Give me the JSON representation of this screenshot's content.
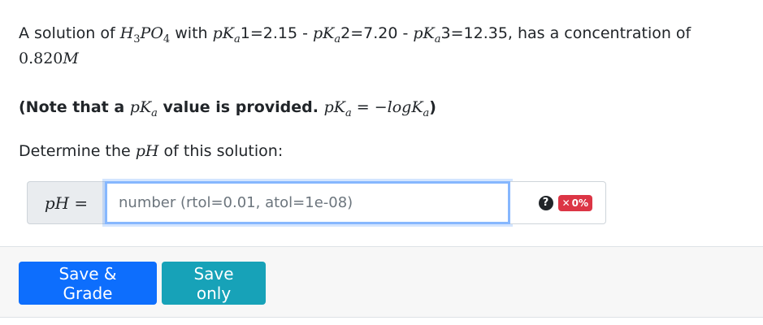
{
  "question": {
    "intro": "A solution of",
    "acid_formula": [
      "H",
      "3",
      "PO",
      "4"
    ],
    "with": "with",
    "pka_values": [
      {
        "label": "pK",
        "sub": "a",
        "suffix": "1=2.15 -"
      },
      {
        "label": "pK",
        "sub": "a",
        "suffix": "2=7.20 -"
      },
      {
        "label": "pK",
        "sub": "a",
        "suffix": "3=12.35, has a concentration of"
      }
    ],
    "concentration_value": "0.820",
    "concentration_unit": "M",
    "note_prefix": "(Note that a",
    "note_pka_symbol": "pK",
    "note_pka_sub": "a",
    "note_middle": "value is provided.",
    "note_formula": "pK",
    "note_formula_sub": "a",
    "note_formula_rhs": "= −logK",
    "note_formula_rhs_sub": "a",
    "note_suffix": ")",
    "prompt_prefix": "Determine the",
    "prompt_symbol": "pH",
    "prompt_suffix": "of this solution:"
  },
  "answer": {
    "label": "pH =",
    "placeholder": "number (rtol=0.01, atol=1e-08)",
    "value": "",
    "help_icon": "question-circle-icon",
    "score_icon": "x-icon",
    "score_symbol": "✕",
    "score": "0%"
  },
  "buttons": {
    "save_grade": "Save & Grade",
    "save_only": "Save only"
  },
  "colors": {
    "primary": "#0d6efd",
    "info": "#17a2b8",
    "danger": "#dc3545",
    "focus_border": "#86b7fe"
  }
}
